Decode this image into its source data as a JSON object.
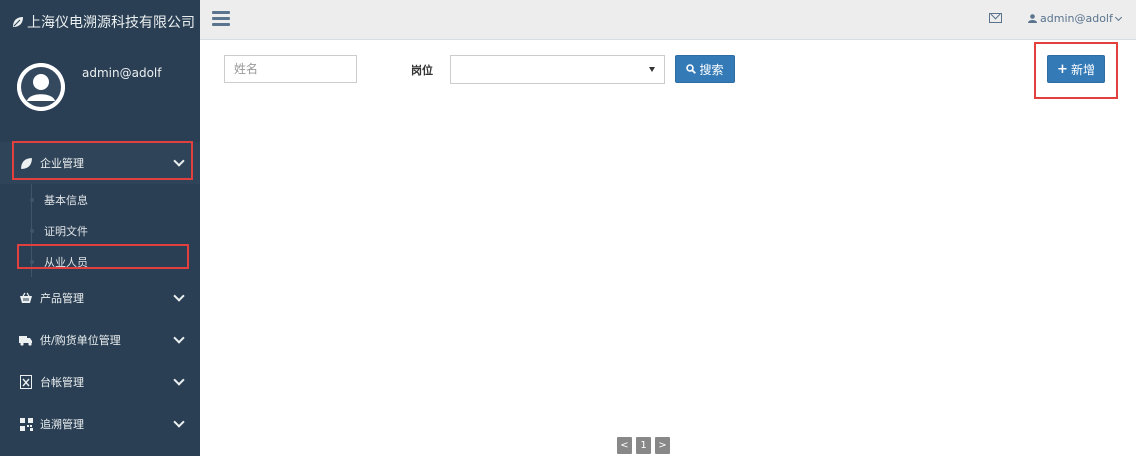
{
  "brand": {
    "title": "上海仪电溯源科技有限公司"
  },
  "profile": {
    "username": "admin@adolf"
  },
  "menu": {
    "items": [
      {
        "label": "企业管理",
        "icon": "leaf-icon"
      },
      {
        "label": "产品管理",
        "icon": "basket-icon"
      },
      {
        "label": "供/购货单位管理",
        "icon": "truck-icon"
      },
      {
        "label": "台帐管理",
        "icon": "excel-icon"
      },
      {
        "label": "追溯管理",
        "icon": "qrcode-icon"
      }
    ],
    "sub_items": [
      {
        "label": "基本信息"
      },
      {
        "label": "证明文件"
      },
      {
        "label": "从业人员"
      }
    ]
  },
  "topnav": {
    "user": "admin@adolf"
  },
  "filters": {
    "name_placeholder": "姓名",
    "position_label": "岗位",
    "position_value": "",
    "search_label": "搜索",
    "add_label": "新增"
  },
  "pagination": {
    "prev": "<",
    "current": "1",
    "next": ">"
  },
  "colors": {
    "sidebar": "#2a3f54",
    "accent": "#1abb9c",
    "primary": "#337ab7",
    "highlight": "#e23f3f"
  }
}
